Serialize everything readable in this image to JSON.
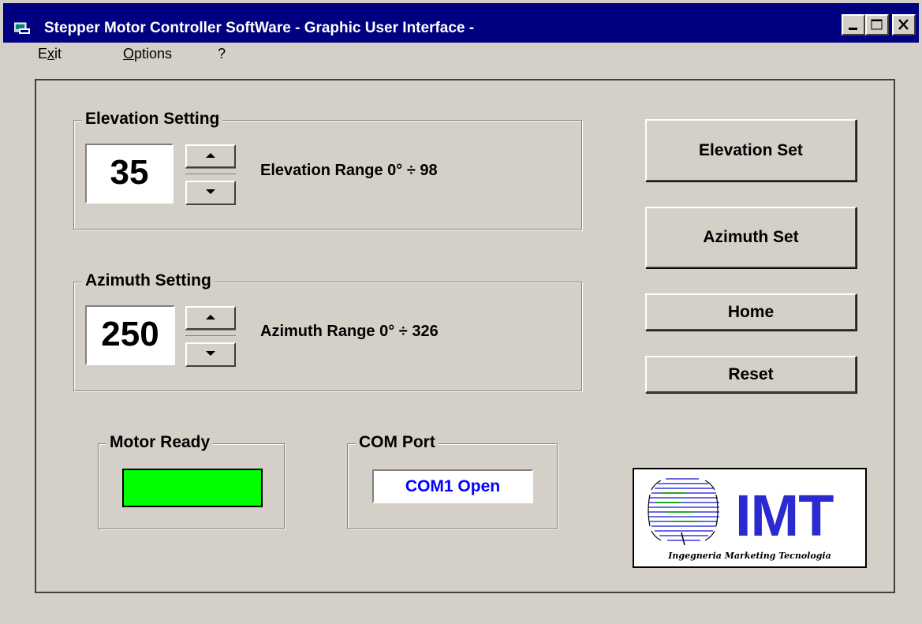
{
  "window": {
    "title": "Stepper Motor Controller SoftWare - Graphic User Interface -",
    "icon": "app-icon",
    "controls": [
      "minimize-icon",
      "maximize-icon",
      "close-icon"
    ]
  },
  "menu": {
    "exit": {
      "first": "E",
      "underline": "x",
      "rest": "it"
    },
    "options": {
      "first": "",
      "underline": "O",
      "rest": "ptions"
    },
    "help": "?"
  },
  "elevation": {
    "group_label": "Elevation Setting",
    "value": "35",
    "range_text": "Elevation Range 0° ÷ 98"
  },
  "azimuth": {
    "group_label": "Azimuth Setting",
    "value": "250",
    "range_text": "Azimuth Range 0° ÷ 326"
  },
  "buttons": {
    "elevation_set": "Elevation Set",
    "azimuth_set": "Azimuth Set",
    "home": "Home",
    "reset": "Reset"
  },
  "motor": {
    "group_label": "Motor Ready",
    "indicator_color": "#00ff00"
  },
  "com": {
    "group_label": "COM Port",
    "status": "COM1 Open",
    "status_color": "#0000ff"
  },
  "logo": {
    "main": "IMT",
    "sub": "Ingegneria Marketing Tecnologia",
    "color": "#2a2ad0"
  }
}
